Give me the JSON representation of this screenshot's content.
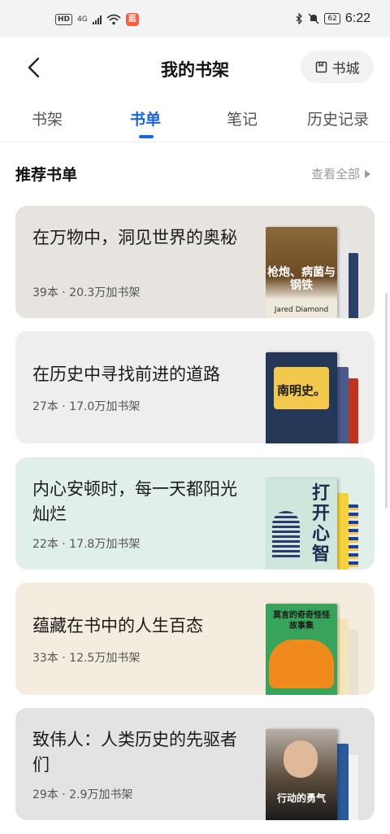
{
  "status_bar": {
    "hd": "HD",
    "network": "4G",
    "app_badge": "逛",
    "battery": "62",
    "time": "6:22"
  },
  "header": {
    "title": "我的书架",
    "store_label": "书城"
  },
  "tabs": [
    {
      "label": "书架",
      "active": false
    },
    {
      "label": "书单",
      "active": true
    },
    {
      "label": "笔记",
      "active": false
    },
    {
      "label": "历史记录",
      "active": false
    }
  ],
  "section": {
    "title": "推荐书单",
    "see_all": "查看全部"
  },
  "booklists": [
    {
      "title": "在万物中，洞见世界的奥秘",
      "meta": "39本 · 20.3万加书架",
      "cover_title": "枪炮、病菌与钢铁",
      "cover_author": "Jared Diamond",
      "bg": "#e7e3df"
    },
    {
      "title": "在历史中寻找前进的道路",
      "meta": "27本 · 17.0万加书架",
      "cover_title": "南明史。",
      "bg": "#eeeeef"
    },
    {
      "title": "内心安顿时，每一天都阳光灿烂",
      "meta": "22本 · 17.8万加书架",
      "cover_title": "打开心智",
      "bg": "#e1efeb"
    },
    {
      "title": "蕴藏在书中的人生百态",
      "meta": "33本 · 12.5万加书架",
      "cover_title": "莫言的奇奇怪怪故事集",
      "bg": "#f4eddf"
    },
    {
      "title": "致伟人：人类历史的先驱者们",
      "meta": "29本 · 2.9万加书架",
      "cover_title": "行动的勇气",
      "bg": "#e3e3e3"
    }
  ]
}
